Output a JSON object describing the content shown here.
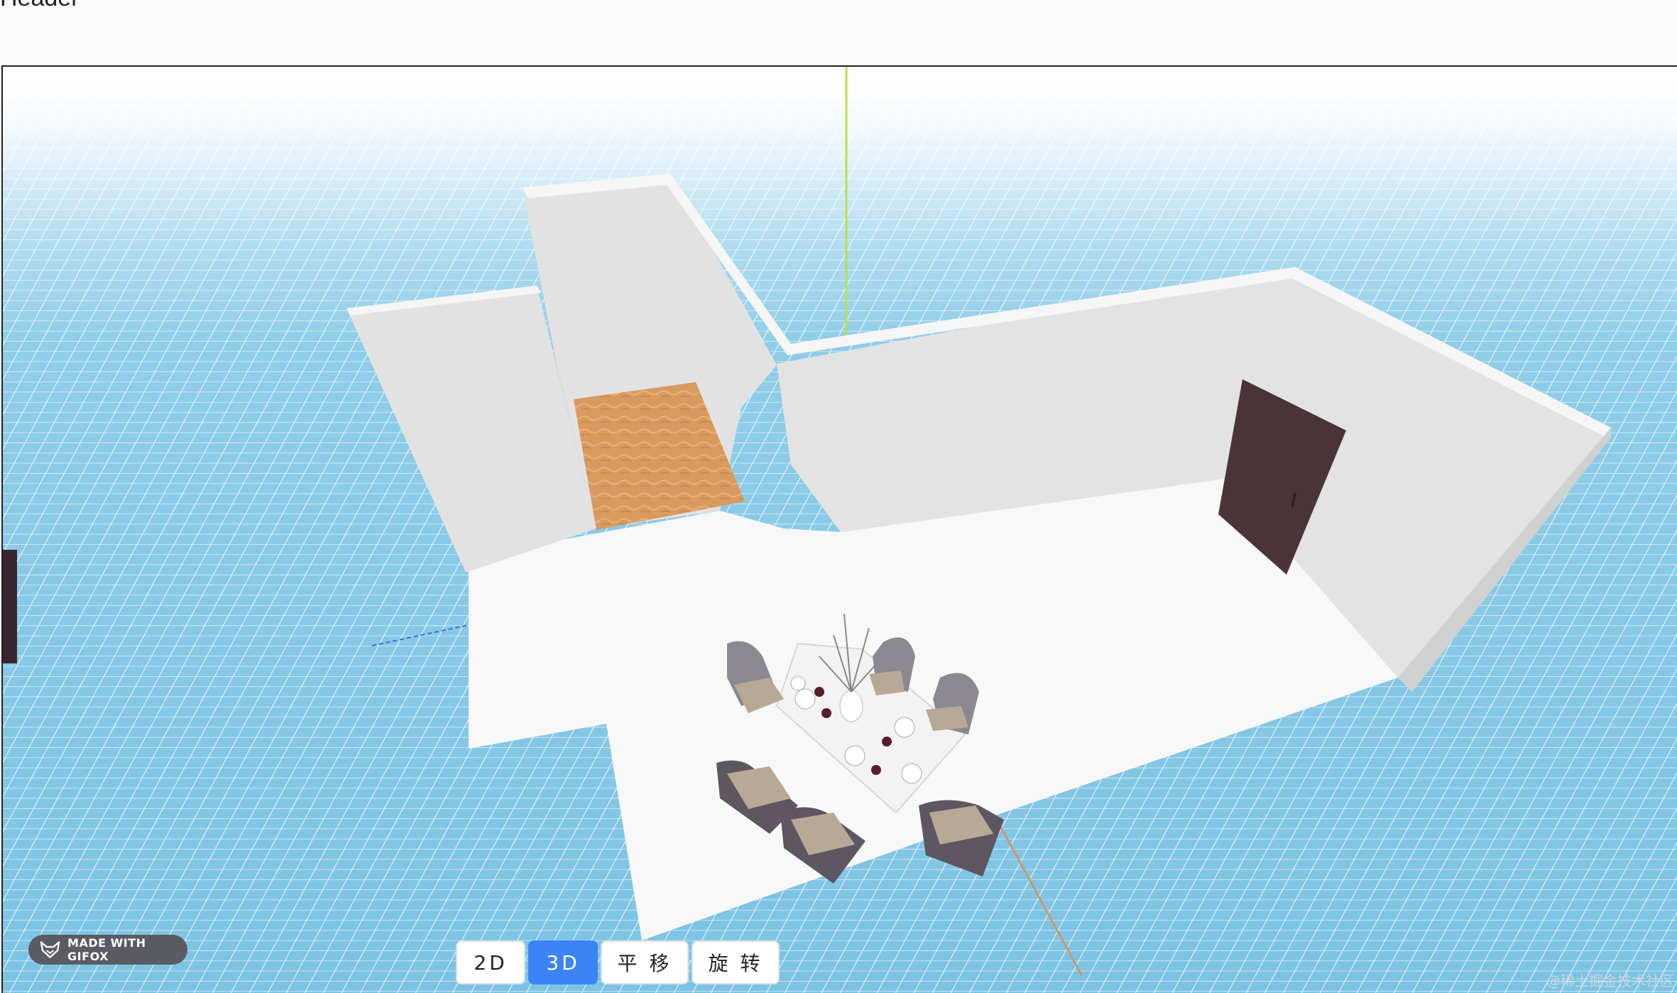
{
  "header": {
    "title": "Header"
  },
  "toolbar": {
    "buttons": [
      {
        "label": "2D",
        "active": false
      },
      {
        "label": "3D",
        "active": true
      },
      {
        "label": "平 移",
        "active": false
      },
      {
        "label": "旋 转",
        "active": false
      }
    ]
  },
  "badge": {
    "label": "MADE WITH GIFOX"
  },
  "watermark": {
    "text": "@稀土掘金技术社区"
  },
  "colors": {
    "accent": "#3c83f6",
    "grid_sky": "#7cc3e3",
    "wall": "#e4e4e4",
    "floor": "#f8f8f8",
    "wood_floor": "#d99a5e",
    "door": "#4a3438"
  }
}
